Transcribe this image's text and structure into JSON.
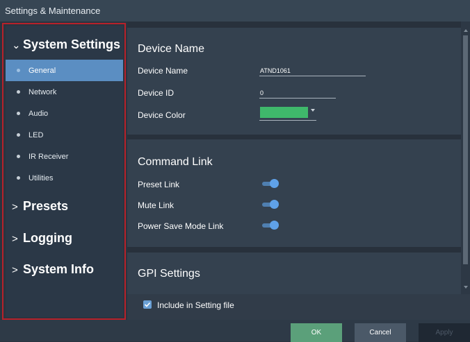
{
  "window": {
    "title": "Settings & Maintenance"
  },
  "sidebar": {
    "system_settings": {
      "label": "System Settings",
      "expanded": true,
      "chevron": "⌄"
    },
    "items": [
      {
        "label": "General",
        "active": true
      },
      {
        "label": "Network",
        "active": false
      },
      {
        "label": "Audio",
        "active": false
      },
      {
        "label": "LED",
        "active": false
      },
      {
        "label": "IR Receiver",
        "active": false
      },
      {
        "label": "Utilities",
        "active": false
      }
    ],
    "presets": {
      "label": "Presets",
      "chevron": ">"
    },
    "logging": {
      "label": "Logging",
      "chevron": ">"
    },
    "system_info": {
      "label": "System Info",
      "chevron": ">"
    }
  },
  "device_name_section": {
    "title": "Device Name",
    "device_name": {
      "label": "Device Name",
      "value": "ATND1061"
    },
    "device_id": {
      "label": "Device ID",
      "value": "0"
    },
    "device_color": {
      "label": "Device Color",
      "value": "#3fb86b"
    }
  },
  "command_link_section": {
    "title": "Command Link",
    "preset_link": {
      "label": "Preset Link",
      "on": true
    },
    "mute_link": {
      "label": "Mute Link",
      "on": true
    },
    "power_save_link": {
      "label": "Power Save Mode Link",
      "on": true
    }
  },
  "gpi_section": {
    "title": "GPI Settings"
  },
  "include_in_setting_file": {
    "label": "Include in Setting file",
    "checked": true
  },
  "buttons": {
    "ok": "OK",
    "cancel": "Cancel",
    "apply": "Apply"
  },
  "colors": {
    "accent": "#5b8ec2",
    "highlight_border": "#b8212a",
    "ok_button": "#5ba07a",
    "toggle_on": "#5fa1e8"
  }
}
